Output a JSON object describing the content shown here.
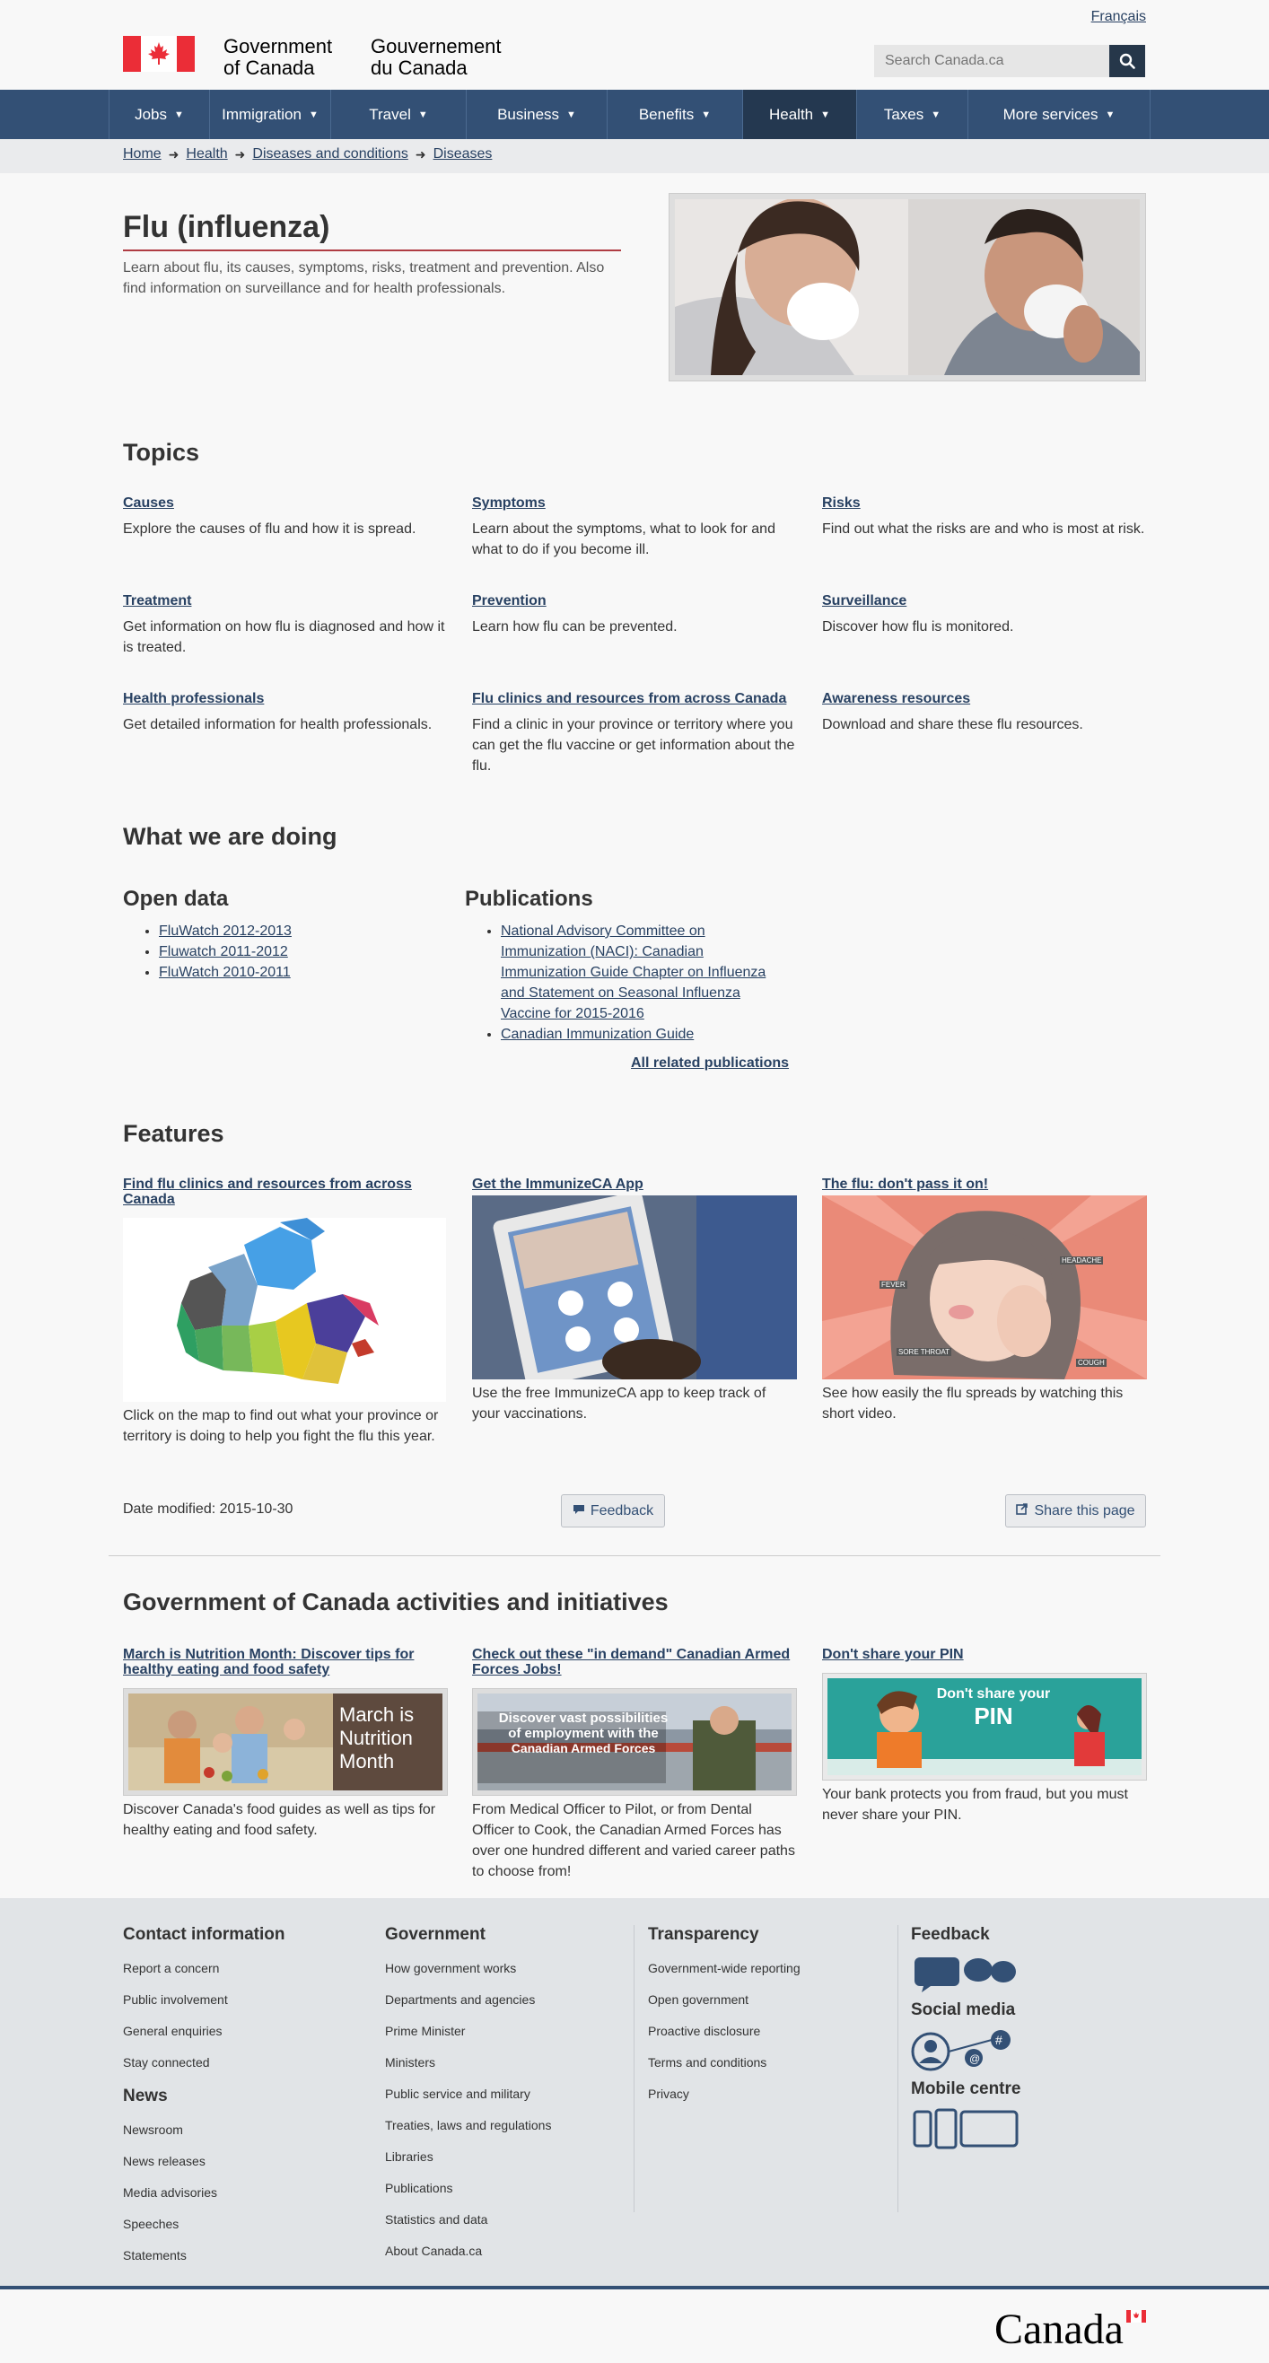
{
  "header": {
    "language_link": "Français",
    "sig_en_1": "Government",
    "sig_en_2": "of Canada",
    "sig_fr_1": "Gouvernement",
    "sig_fr_2": "du Canada",
    "search_placeholder": "Search Canada.ca"
  },
  "nav": {
    "items": [
      {
        "label": "Jobs"
      },
      {
        "label": "Immigration"
      },
      {
        "label": "Travel"
      },
      {
        "label": "Business"
      },
      {
        "label": "Benefits"
      },
      {
        "label": "Health"
      },
      {
        "label": "Taxes"
      },
      {
        "label": "More services"
      }
    ]
  },
  "breadcrumb": [
    "Home",
    "Health",
    "Diseases and conditions",
    "Diseases"
  ],
  "page": {
    "title": "Flu (influenza)",
    "intro": "Learn about flu, its causes, symptoms, risks, treatment and prevention. Also find information on surveillance and for health professionals."
  },
  "topics": {
    "heading": "Topics",
    "items": [
      {
        "title": "Causes",
        "desc": "Explore the causes of flu and how it is spread."
      },
      {
        "title": "Symptoms",
        "desc": "Learn about the symptoms, what to look for and what to do if you become ill."
      },
      {
        "title": "Risks",
        "desc": "Find out what the risks are and who is most at risk."
      },
      {
        "title": "Treatment",
        "desc": "Get information on how flu is diagnosed and how it is treated."
      },
      {
        "title": "Prevention",
        "desc": "Learn how flu can be prevented."
      },
      {
        "title": "Surveillance",
        "desc": "Discover how flu is monitored."
      },
      {
        "title": "Health professionals",
        "desc": "Get detailed information for health professionals."
      },
      {
        "title": "Flu clinics and resources from across Canada",
        "desc": "Find a clinic in your province or territory where you can get the flu vaccine or get information about the flu."
      },
      {
        "title": "Awareness resources",
        "desc": "Download and share these flu resources."
      }
    ]
  },
  "doing": {
    "heading": "What we are doing",
    "open_data_heading": "Open data",
    "open_data": [
      "FluWatch 2012-2013",
      "Fluwatch 2011-2012",
      "FluWatch 2010-2011"
    ],
    "publications_heading": "Publications",
    "publications": [
      "National Advisory Committee on Immunization (NACI): Canadian Immunization Guide Chapter on Influenza and Statement on Seasonal Influenza Vaccine for 2015-2016",
      "Canadian Immunization Guide"
    ],
    "all_publications": "All related publications"
  },
  "features": {
    "heading": "Features",
    "items": [
      {
        "title": "Find flu clinics and resources from across Canada",
        "desc": "Click on the map to find out what your province or territory is doing to help you fight the flu this year."
      },
      {
        "title": "Get the ImmunizeCA App",
        "desc": "Use the free ImmunizeCA app to keep track of your vaccinations."
      },
      {
        "title": "The flu: don't pass it on!",
        "desc": "See how easily the flu spreads by watching this short video."
      }
    ],
    "flu_labels": [
      "HEADACHE",
      "FEVER",
      "SORE THROAT",
      "COUGH"
    ]
  },
  "meta": {
    "date_modified": "Date modified: 2015-10-30",
    "feedback_button": "Feedback",
    "share_button": "Share this page"
  },
  "gc": {
    "heading": "Government of Canada activities and initiatives",
    "items": [
      {
        "title": "March is Nutrition Month: Discover tips for healthy eating and food safety",
        "desc": "Discover Canada's food guides as well as tips for healthy eating and food safety.",
        "img_text": "March is Nutrition Month"
      },
      {
        "title": "Check out these \"in demand\" Canadian Armed Forces Jobs!",
        "desc": "From Medical Officer to Pilot, or from Dental Officer to Cook, the Canadian Armed Forces has over one hundred different and varied career paths to choose from!",
        "img_text_1": "Discover vast possibilities",
        "img_text_2": "of employment with the",
        "img_text_3": "Canadian Armed Forces"
      },
      {
        "title": "Don't share your PIN",
        "desc": "Your bank protects you from fraud, but you must never share your PIN.",
        "img_text_1": "Don't share your",
        "img_text_2": "PIN"
      }
    ]
  },
  "footer": {
    "contact": {
      "heading": "Contact information",
      "items": [
        "Report a concern",
        "Public involvement",
        "General enquiries",
        "Stay connected"
      ]
    },
    "news": {
      "heading": "News",
      "items": [
        "Newsroom",
        "News releases",
        "Media advisories",
        "Speeches",
        "Statements"
      ]
    },
    "government": {
      "heading": "Government",
      "items": [
        "How government works",
        "Departments and agencies",
        "Prime Minister",
        "Ministers",
        "Public service and military",
        "Treaties, laws and regulations",
        "Libraries",
        "Publications",
        "Statistics and data",
        "About Canada.ca"
      ]
    },
    "transparency": {
      "heading": "Transparency",
      "items": [
        "Government-wide reporting",
        "Open government",
        "Proactive disclosure",
        "Terms and conditions",
        "Privacy"
      ]
    },
    "feedback_heading": "Feedback",
    "social_heading": "Social media",
    "mobile_heading": "Mobile centre",
    "wordmark": "Canada"
  },
  "colors": {
    "nav": "#335075",
    "nav_active": "#243850",
    "link": "#284162",
    "flag_red": "#eb2d37",
    "footer_bg": "#e1e4e7"
  }
}
